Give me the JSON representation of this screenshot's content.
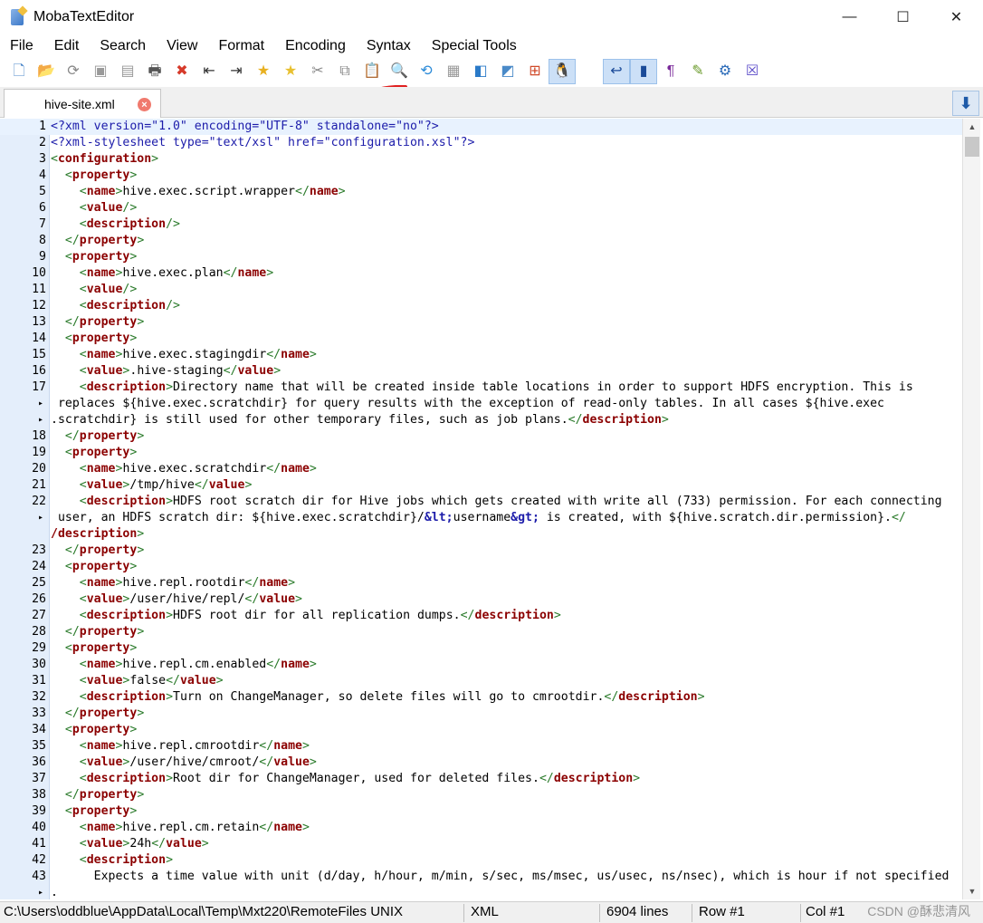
{
  "app": {
    "title": "MobaTextEditor"
  },
  "window_controls": {
    "minimize": "—",
    "maximize": "☐",
    "close": "✕"
  },
  "menu": [
    "File",
    "Edit",
    "Search",
    "View",
    "Format",
    "Encoding",
    "Syntax",
    "Special Tools"
  ],
  "toolbar": [
    {
      "icon": "new-file-icon",
      "glyph": "🗋",
      "color": "#4a86c8"
    },
    {
      "icon": "open-folder-icon",
      "glyph": "📂",
      "color": "#e6a020"
    },
    {
      "icon": "reload-icon",
      "glyph": "⟳",
      "color": "#888888"
    },
    {
      "icon": "save-icon",
      "glyph": "▣",
      "color": "#9a9a9a"
    },
    {
      "icon": "save-all-icon",
      "glyph": "▤",
      "color": "#9a9a9a"
    },
    {
      "icon": "print-icon",
      "glyph": "🖶",
      "color": "#555555"
    },
    {
      "icon": "close-file-icon",
      "glyph": "✖",
      "color": "#d63a2a"
    },
    {
      "icon": "unindent-icon",
      "glyph": "⇤",
      "color": "#333333"
    },
    {
      "icon": "indent-icon",
      "glyph": "⇥",
      "color": "#333333"
    },
    {
      "icon": "bookmark-add-icon",
      "glyph": "★",
      "color": "#e8b020"
    },
    {
      "icon": "bookmark-next-icon",
      "glyph": "★",
      "color": "#e8c030"
    },
    {
      "icon": "cut-icon",
      "glyph": "✂",
      "color": "#888888"
    },
    {
      "icon": "copy-icon",
      "glyph": "⧉",
      "color": "#888888"
    },
    {
      "icon": "paste-icon",
      "glyph": "📋",
      "color": "#3a6aa8"
    },
    {
      "icon": "search-icon",
      "glyph": "🔍",
      "color": "#2a6ab8"
    },
    {
      "icon": "replace-icon",
      "glyph": "⟲",
      "color": "#2a8ad8"
    },
    {
      "icon": "macro-icon",
      "glyph": "▦",
      "color": "#9a9a9a"
    },
    {
      "icon": "compare-icon",
      "glyph": "◧",
      "color": "#2a7ac8"
    },
    {
      "icon": "sync-icon",
      "glyph": "◩",
      "color": "#4a8ac8"
    },
    {
      "icon": "windows-eol-icon",
      "glyph": "⊞",
      "color": "#d04a2a"
    },
    {
      "icon": "linux-eol-icon",
      "glyph": "🐧",
      "color": "#222222",
      "active": true
    },
    {
      "icon": "mac-eol-icon",
      "glyph": "",
      "color": "#1a5aa8"
    },
    {
      "icon": "word-wrap-icon",
      "glyph": "↩",
      "color": "#1a4a98",
      "active": true
    },
    {
      "icon": "line-numbers-icon",
      "glyph": "▮",
      "color": "#1a4a98",
      "active": true
    },
    {
      "icon": "show-symbols-icon",
      "glyph": "¶",
      "color": "#7a2a9a"
    },
    {
      "icon": "highlight-icon",
      "glyph": "✎",
      "color": "#6a9a2a"
    },
    {
      "icon": "settings-icon",
      "glyph": "⚙",
      "color": "#2a6ab8"
    },
    {
      "icon": "exit-icon",
      "glyph": "☒",
      "color": "#5a4ac8"
    }
  ],
  "tab": {
    "label": "hive-site.xml",
    "close": "×"
  },
  "tab_scroll": "⬇",
  "lines": [
    {
      "n": "1",
      "h": "<span class='pi'>&lt;?xml version=\"1.0\" encoding=\"UTF-8\" standalone=\"no\"?&gt;</span>",
      "cur": true
    },
    {
      "n": "2",
      "h": "<span class='pi'>&lt;?xml-stylesheet type=\"text/xsl\" href=\"configuration.xsl\"?&gt;</span>"
    },
    {
      "n": "3",
      "h": "<span class='br'>&lt;</span><span class='tag'>configuration</span><span class='br'>&gt;</span>"
    },
    {
      "n": "4",
      "h": "  <span class='br'>&lt;</span><span class='tag'>property</span><span class='br'>&gt;</span>"
    },
    {
      "n": "5",
      "h": "    <span class='br'>&lt;</span><span class='tag'>name</span><span class='br'>&gt;</span>hive.exec.script.wrapper<span class='br'>&lt;/</span><span class='tag'>name</span><span class='br'>&gt;</span>"
    },
    {
      "n": "6",
      "h": "    <span class='br'>&lt;</span><span class='tag'>value</span><span class='br'>/&gt;</span>"
    },
    {
      "n": "7",
      "h": "    <span class='br'>&lt;</span><span class='tag'>description</span><span class='br'>/&gt;</span>"
    },
    {
      "n": "8",
      "h": "  <span class='br'>&lt;/</span><span class='tag'>property</span><span class='br'>&gt;</span>"
    },
    {
      "n": "9",
      "h": "  <span class='br'>&lt;</span><span class='tag'>property</span><span class='br'>&gt;</span>"
    },
    {
      "n": "10",
      "h": "    <span class='br'>&lt;</span><span class='tag'>name</span><span class='br'>&gt;</span>hive.exec.plan<span class='br'>&lt;/</span><span class='tag'>name</span><span class='br'>&gt;</span>"
    },
    {
      "n": "11",
      "h": "    <span class='br'>&lt;</span><span class='tag'>value</span><span class='br'>/&gt;</span>"
    },
    {
      "n": "12",
      "h": "    <span class='br'>&lt;</span><span class='tag'>description</span><span class='br'>/&gt;</span>"
    },
    {
      "n": "13",
      "h": "  <span class='br'>&lt;/</span><span class='tag'>property</span><span class='br'>&gt;</span>"
    },
    {
      "n": "14",
      "h": "  <span class='br'>&lt;</span><span class='tag'>property</span><span class='br'>&gt;</span>"
    },
    {
      "n": "15",
      "h": "    <span class='br'>&lt;</span><span class='tag'>name</span><span class='br'>&gt;</span>hive.exec.stagingdir<span class='br'>&lt;/</span><span class='tag'>name</span><span class='br'>&gt;</span>"
    },
    {
      "n": "16",
      "h": "    <span class='br'>&lt;</span><span class='tag'>value</span><span class='br'>&gt;</span>.hive-staging<span class='br'>&lt;/</span><span class='tag'>value</span><span class='br'>&gt;</span>"
    },
    {
      "n": "17",
      "h": "    <span class='br'>&lt;</span><span class='tag'>description</span><span class='br'>&gt;</span>Directory name that will be created inside table locations in order to support HDFS encryption. This is"
    },
    {
      "n": "",
      "wrap": true,
      "h": " replaces ${hive.exec.scratchdir} for query results with the exception of read-only tables. In all cases ${hive.exec"
    },
    {
      "n": "",
      "wrap": true,
      "h": ".scratchdir} is still used for other temporary files, such as job plans.<span class='br'>&lt;/</span><span class='tag'>description</span><span class='br'>&gt;</span>"
    },
    {
      "n": "18",
      "h": "  <span class='br'>&lt;/</span><span class='tag'>property</span><span class='br'>&gt;</span>"
    },
    {
      "n": "19",
      "h": "  <span class='br'>&lt;</span><span class='tag'>property</span><span class='br'>&gt;</span>"
    },
    {
      "n": "20",
      "h": "    <span class='br'>&lt;</span><span class='tag'>name</span><span class='br'>&gt;</span>hive.exec.scratchdir<span class='br'>&lt;/</span><span class='tag'>name</span><span class='br'>&gt;</span>"
    },
    {
      "n": "21",
      "h": "    <span class='br'>&lt;</span><span class='tag'>value</span><span class='br'>&gt;</span>/tmp/hive<span class='br'>&lt;/</span><span class='tag'>value</span><span class='br'>&gt;</span>"
    },
    {
      "n": "22",
      "h": "    <span class='br'>&lt;</span><span class='tag'>description</span><span class='br'>&gt;</span>HDFS root scratch dir for Hive jobs which gets created with write all (733) permission. For each connecting"
    },
    {
      "n": "",
      "wrap": true,
      "h": " user, an HDFS scratch dir: ${hive.exec.scratchdir}/<span class='ent'>&amp;lt;</span>username<span class='ent'>&amp;gt;</span> is created, with ${hive.scratch.dir.permission}.<span class='br'>&lt;/</span>"
    },
    {
      "n": "",
      "h": "<span class='tag'>/description</span><span class='br'>&gt;</span>"
    },
    {
      "n": "23",
      "h": "  <span class='br'>&lt;/</span><span class='tag'>property</span><span class='br'>&gt;</span>"
    },
    {
      "n": "24",
      "h": "  <span class='br'>&lt;</span><span class='tag'>property</span><span class='br'>&gt;</span>"
    },
    {
      "n": "25",
      "h": "    <span class='br'>&lt;</span><span class='tag'>name</span><span class='br'>&gt;</span>hive.repl.rootdir<span class='br'>&lt;/</span><span class='tag'>name</span><span class='br'>&gt;</span>"
    },
    {
      "n": "26",
      "h": "    <span class='br'>&lt;</span><span class='tag'>value</span><span class='br'>&gt;</span>/user/hive/repl/<span class='br'>&lt;/</span><span class='tag'>value</span><span class='br'>&gt;</span>"
    },
    {
      "n": "27",
      "h": "    <span class='br'>&lt;</span><span class='tag'>description</span><span class='br'>&gt;</span>HDFS root dir for all replication dumps.<span class='br'>&lt;/</span><span class='tag'>description</span><span class='br'>&gt;</span>"
    },
    {
      "n": "28",
      "h": "  <span class='br'>&lt;/</span><span class='tag'>property</span><span class='br'>&gt;</span>"
    },
    {
      "n": "29",
      "h": "  <span class='br'>&lt;</span><span class='tag'>property</span><span class='br'>&gt;</span>"
    },
    {
      "n": "30",
      "h": "    <span class='br'>&lt;</span><span class='tag'>name</span><span class='br'>&gt;</span>hive.repl.cm.enabled<span class='br'>&lt;/</span><span class='tag'>name</span><span class='br'>&gt;</span>"
    },
    {
      "n": "31",
      "h": "    <span class='br'>&lt;</span><span class='tag'>value</span><span class='br'>&gt;</span>false<span class='br'>&lt;/</span><span class='tag'>value</span><span class='br'>&gt;</span>"
    },
    {
      "n": "32",
      "h": "    <span class='br'>&lt;</span><span class='tag'>description</span><span class='br'>&gt;</span>Turn on ChangeManager, so delete files will go to cmrootdir.<span class='br'>&lt;/</span><span class='tag'>description</span><span class='br'>&gt;</span>"
    },
    {
      "n": "33",
      "h": "  <span class='br'>&lt;/</span><span class='tag'>property</span><span class='br'>&gt;</span>"
    },
    {
      "n": "34",
      "h": "  <span class='br'>&lt;</span><span class='tag'>property</span><span class='br'>&gt;</span>"
    },
    {
      "n": "35",
      "h": "    <span class='br'>&lt;</span><span class='tag'>name</span><span class='br'>&gt;</span>hive.repl.cmrootdir<span class='br'>&lt;/</span><span class='tag'>name</span><span class='br'>&gt;</span>"
    },
    {
      "n": "36",
      "h": "    <span class='br'>&lt;</span><span class='tag'>value</span><span class='br'>&gt;</span>/user/hive/cmroot/<span class='br'>&lt;/</span><span class='tag'>value</span><span class='br'>&gt;</span>"
    },
    {
      "n": "37",
      "h": "    <span class='br'>&lt;</span><span class='tag'>description</span><span class='br'>&gt;</span>Root dir for ChangeManager, used for deleted files.<span class='br'>&lt;/</span><span class='tag'>description</span><span class='br'>&gt;</span>"
    },
    {
      "n": "38",
      "h": "  <span class='br'>&lt;/</span><span class='tag'>property</span><span class='br'>&gt;</span>"
    },
    {
      "n": "39",
      "h": "  <span class='br'>&lt;</span><span class='tag'>property</span><span class='br'>&gt;</span>"
    },
    {
      "n": "40",
      "h": "    <span class='br'>&lt;</span><span class='tag'>name</span><span class='br'>&gt;</span>hive.repl.cm.retain<span class='br'>&lt;/</span><span class='tag'>name</span><span class='br'>&gt;</span>"
    },
    {
      "n": "41",
      "h": "    <span class='br'>&lt;</span><span class='tag'>value</span><span class='br'>&gt;</span>24h<span class='br'>&lt;/</span><span class='tag'>value</span><span class='br'>&gt;</span>"
    },
    {
      "n": "42",
      "h": "    <span class='br'>&lt;</span><span class='tag'>description</span><span class='br'>&gt;</span>"
    },
    {
      "n": "43",
      "h": "      Expects a time value with unit (d/day, h/hour, m/min, s/sec, ms/msec, us/usec, ns/nsec), which is hour if not specified"
    },
    {
      "n": "",
      "wrap": true,
      "h": "."
    }
  ],
  "scrollbar": {
    "up": "▲",
    "down": "▼"
  },
  "status": {
    "path": "C:\\Users\\oddblue\\AppData\\Local\\Temp\\Mxt220\\RemoteFiles UNIX",
    "syntax": "XML",
    "lines": "6904 lines",
    "row": "Row #1",
    "col": "Col #1"
  },
  "watermark": "CSDN @酥悲清风"
}
